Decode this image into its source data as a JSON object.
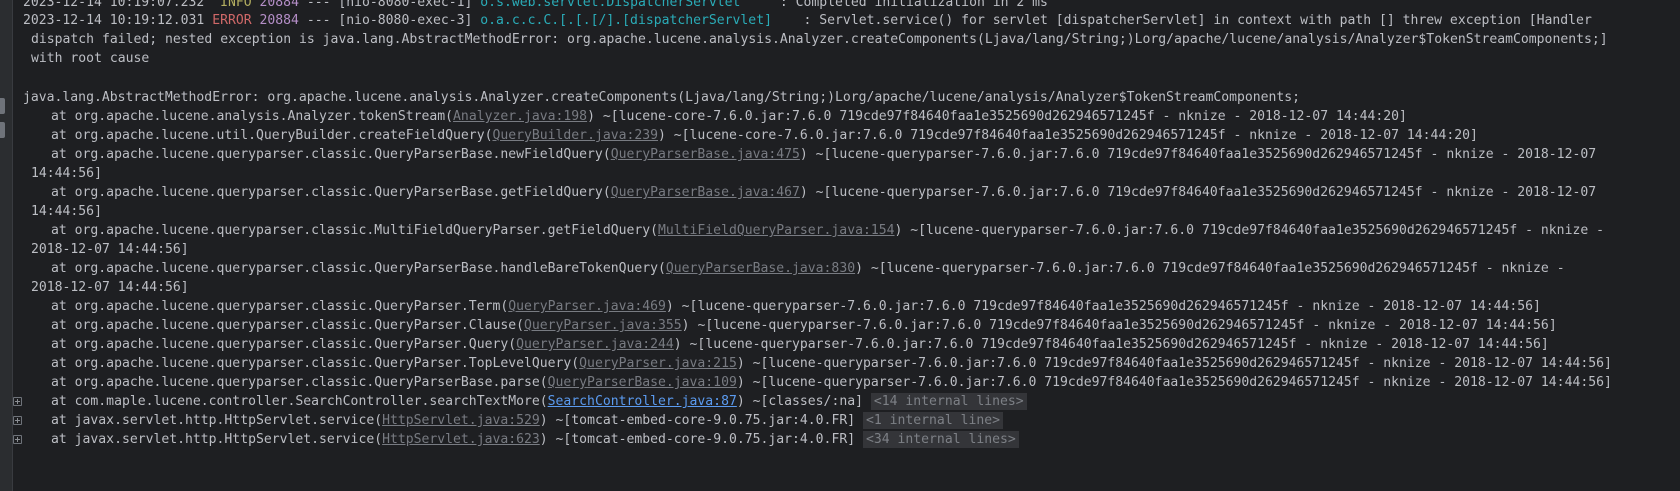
{
  "header": {
    "row0": {
      "date": "2023-12-14 10:19:07.232",
      "level": "INFO",
      "pid": "20884",
      "sep": "---",
      "thread": "[nio-8080-exec-1]",
      "logger": "o.s.web.servlet.DispatcherServlet",
      "message": ": Completed initialization in 2 ms"
    },
    "row1": {
      "date": "2023-12-14 10:19:12.031",
      "level": "ERROR",
      "pid": "20884",
      "sep": "---",
      "thread": "[nio-8080-exec-3]",
      "logger": "o.a.c.c.C.[.[.[/].[dispatcherServlet]",
      "message": ": Servlet.service() for servlet [dispatcherServlet] in context with path [] threw exception [Handler"
    },
    "wrap1": "dispatch failed; nested exception is java.lang.AbstractMethodError: org.apache.lucene.analysis.Analyzer.createComponents(Ljava/lang/String;)Lorg/apache/lucene/analysis/Analyzer$TokenStreamComponents;]",
    "wrap2": "with root cause"
  },
  "exception": "java.lang.AbstractMethodError: org.apache.lucene.analysis.Analyzer.createComponents(Ljava/lang/String;)Lorg/apache/lucene/analysis/Analyzer$TokenStreamComponents;",
  "frames": [
    {
      "pre": "at org.apache.lucene.analysis.Analyzer.tokenStream(",
      "src": "Analyzer.java:198",
      "post": ") ~[lucene-core-7.6.0.jar:7.6.0 719cde97f84640faa1e3525690d262946571245f - nknize - 2018-12-07 14:44:20]",
      "cont": ""
    },
    {
      "pre": "at org.apache.lucene.util.QueryBuilder.createFieldQuery(",
      "src": "QueryBuilder.java:239",
      "post": ") ~[lucene-core-7.6.0.jar:7.6.0 719cde97f84640faa1e3525690d262946571245f - nknize - 2018-12-07 14:44:20]",
      "cont": ""
    },
    {
      "pre": "at org.apache.lucene.queryparser.classic.QueryParserBase.newFieldQuery(",
      "src": "QueryParserBase.java:475",
      "post": ") ~[lucene-queryparser-7.6.0.jar:7.6.0 719cde97f84640faa1e3525690d262946571245f - nknize - 2018-12-07",
      "cont": "14:44:56]"
    },
    {
      "pre": "at org.apache.lucene.queryparser.classic.QueryParserBase.getFieldQuery(",
      "src": "QueryParserBase.java:467",
      "post": ") ~[lucene-queryparser-7.6.0.jar:7.6.0 719cde97f84640faa1e3525690d262946571245f - nknize - 2018-12-07",
      "cont": "14:44:56]"
    },
    {
      "pre": "at org.apache.lucene.queryparser.classic.MultiFieldQueryParser.getFieldQuery(",
      "src": "MultiFieldQueryParser.java:154",
      "post": ") ~[lucene-queryparser-7.6.0.jar:7.6.0 719cde97f84640faa1e3525690d262946571245f - nknize -",
      "cont": "2018-12-07 14:44:56]"
    },
    {
      "pre": "at org.apache.lucene.queryparser.classic.QueryParserBase.handleBareTokenQuery(",
      "src": "QueryParserBase.java:830",
      "post": ") ~[lucene-queryparser-7.6.0.jar:7.6.0 719cde97f84640faa1e3525690d262946571245f - nknize -",
      "cont": "2018-12-07 14:44:56]"
    },
    {
      "pre": "at org.apache.lucene.queryparser.classic.QueryParser.Term(",
      "src": "QueryParser.java:469",
      "post": ") ~[lucene-queryparser-7.6.0.jar:7.6.0 719cde97f84640faa1e3525690d262946571245f - nknize - 2018-12-07 14:44:56]",
      "cont": ""
    },
    {
      "pre": "at org.apache.lucene.queryparser.classic.QueryParser.Clause(",
      "src": "QueryParser.java:355",
      "post": ") ~[lucene-queryparser-7.6.0.jar:7.6.0 719cde97f84640faa1e3525690d262946571245f - nknize - 2018-12-07 14:44:56]",
      "cont": ""
    },
    {
      "pre": "at org.apache.lucene.queryparser.classic.QueryParser.Query(",
      "src": "QueryParser.java:244",
      "post": ") ~[lucene-queryparser-7.6.0.jar:7.6.0 719cde97f84640faa1e3525690d262946571245f - nknize - 2018-12-07 14:44:56]",
      "cont": ""
    },
    {
      "pre": "at org.apache.lucene.queryparser.classic.QueryParser.TopLevelQuery(",
      "src": "QueryParser.java:215",
      "post": ") ~[lucene-queryparser-7.6.0.jar:7.6.0 719cde97f84640faa1e3525690d262946571245f - nknize - 2018-12-07 14:44:56]",
      "cont": ""
    },
    {
      "pre": "at org.apache.lucene.queryparser.classic.QueryParserBase.parse(",
      "src": "QueryParserBase.java:109",
      "post": ") ~[lucene-queryparser-7.6.0.jar:7.6.0 719cde97f84640faa1e3525690d262946571245f - nknize - 2018-12-07 14:44:56]",
      "cont": ""
    }
  ],
  "folded": [
    {
      "pre": "at com.maple.lucene.controller.SearchController.searchTextMore(",
      "src": "SearchController.java:87",
      "post": ") ~[classes/:na]",
      "badge": "<14 internal lines>"
    },
    {
      "pre": "at javax.servlet.http.HttpServlet.service(",
      "src": "HttpServlet.java:529",
      "post": ") ~[tomcat-embed-core-9.0.75.jar:4.0.FR]",
      "badge": "<1 internal line>"
    },
    {
      "pre": "at javax.servlet.http.HttpServlet.service(",
      "src": "HttpServlet.java:623",
      "post": ") ~[tomcat-embed-core-9.0.75.jar:4.0.FR]",
      "badge": "<34 internal lines>"
    }
  ]
}
